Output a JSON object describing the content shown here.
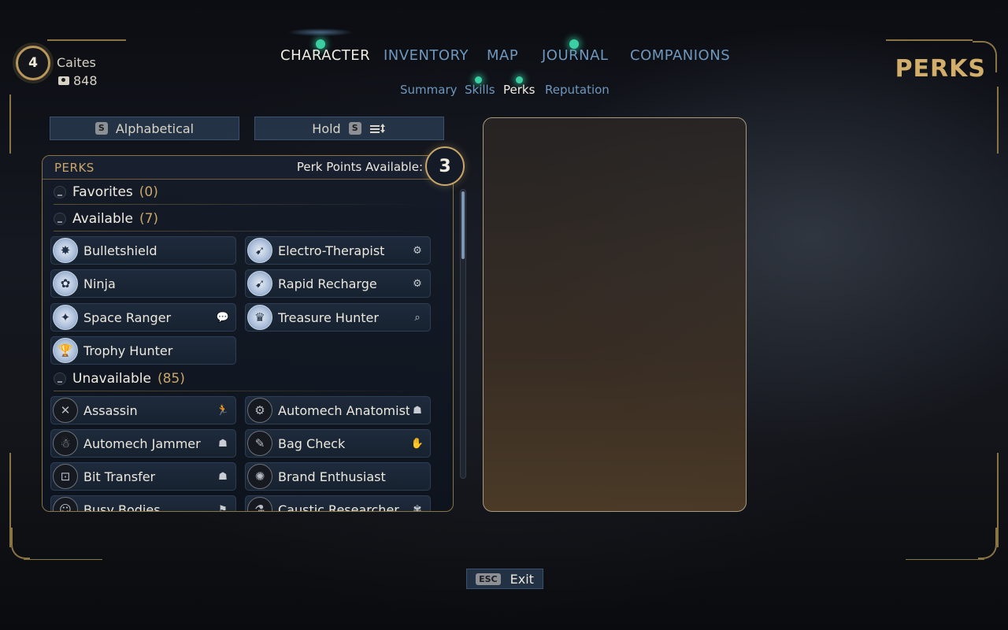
{
  "player": {
    "level": "4",
    "name": "Caites",
    "credits": "848",
    "credits_icon": "credits-icon"
  },
  "tabs": [
    {
      "label": "CHARACTER",
      "active": true,
      "notification": true
    },
    {
      "label": "INVENTORY",
      "active": false,
      "notification": false
    },
    {
      "label": "MAP",
      "active": false,
      "notification": false
    },
    {
      "label": "JOURNAL",
      "active": false,
      "notification": true
    },
    {
      "label": "COMPANIONS",
      "active": false,
      "notification": false
    }
  ],
  "subtabs": [
    {
      "label": "Summary",
      "active": false,
      "notification": false
    },
    {
      "label": "Skills",
      "active": false,
      "notification": true
    },
    {
      "label": "Perks",
      "active": true,
      "notification": true
    },
    {
      "label": "Reputation",
      "active": false,
      "notification": false
    }
  ],
  "page_title": "PERKS",
  "sort": {
    "key": "S",
    "label": "Alphabetical",
    "hold_label": "Hold",
    "hold_key": "S",
    "hold_icon": "sort-order-icon"
  },
  "panel": {
    "title": "PERKS",
    "points_label": "Perk Points Available:",
    "points_value": "3"
  },
  "categories": [
    {
      "label": "Favorites",
      "count": "(0)"
    },
    {
      "label": "Available",
      "count": "(7)"
    },
    {
      "label": "Unavailable",
      "count": "(85)"
    }
  ],
  "available_perks": [
    {
      "label": "Bulletshield",
      "icon": "bulletshield-icon",
      "tag": ""
    },
    {
      "label": "Electro-Therapist",
      "icon": "electro-therapist-icon",
      "tag": "gear-tag-icon"
    },
    {
      "label": "Ninja",
      "icon": "ninja-icon",
      "tag": ""
    },
    {
      "label": "Rapid Recharge",
      "icon": "rapid-recharge-icon",
      "tag": "gear-tag-icon"
    },
    {
      "label": "Space Ranger",
      "icon": "space-ranger-icon",
      "tag": "speech-tag-icon"
    },
    {
      "label": "Treasure Hunter",
      "icon": "treasure-hunter-icon",
      "tag": "search-tag-icon"
    },
    {
      "label": "Trophy Hunter",
      "icon": "trophy-icon",
      "tag": ""
    }
  ],
  "unavailable_perks": [
    {
      "label": "Assassin",
      "icon": "assassin-icon",
      "tag": "stealth-tag-icon"
    },
    {
      "label": "Automech Anatomist",
      "icon": "automech-anatomist-icon",
      "tag": "robot-tag-icon"
    },
    {
      "label": "Automech Jammer",
      "icon": "automech-jammer-icon",
      "tag": "robot-tag-icon"
    },
    {
      "label": "Bag Check",
      "icon": "bag-check-icon",
      "tag": "hand-tag-icon"
    },
    {
      "label": "Bit Transfer",
      "icon": "bit-transfer-icon",
      "tag": "robot-tag-icon"
    },
    {
      "label": "Brand Enthusiast",
      "icon": "brand-enthusiast-icon",
      "tag": ""
    },
    {
      "label": "Busy Bodies",
      "icon": "busy-bodies-icon",
      "tag": "flag-tag-icon"
    },
    {
      "label": "Caustic Researcher",
      "icon": "caustic-researcher-icon",
      "tag": "brain-tag-icon"
    }
  ],
  "exit": {
    "key": "ESC",
    "label": "Exit"
  },
  "colors": {
    "gold": "#c9a66a",
    "tab_inactive": "#6f97bd",
    "notification": "#3ad0a4"
  }
}
